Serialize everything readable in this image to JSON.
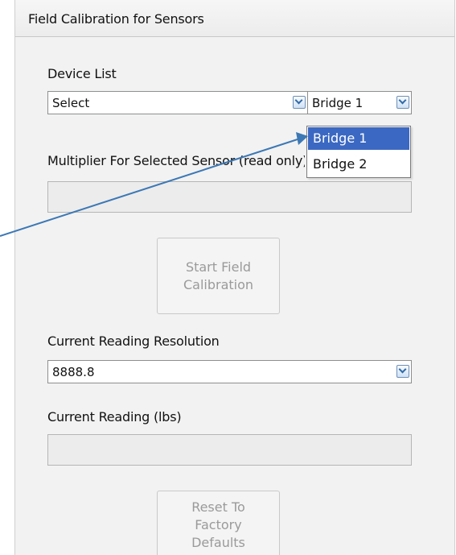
{
  "panel": {
    "title": "Field Calibration for Sensors"
  },
  "device_list": {
    "label": "Device List",
    "value": "Select",
    "icon": "chevron-down-icon"
  },
  "bridge_select": {
    "value": "Bridge 1",
    "icon": "chevron-down-icon",
    "options": [
      {
        "label": "Bridge 1",
        "selected": true
      },
      {
        "label": "Bridge 2",
        "selected": false
      }
    ]
  },
  "multiplier": {
    "label": "Multiplier For Selected Sensor (read only)",
    "value": ""
  },
  "start_button": {
    "label": "Start Field Calibration"
  },
  "resolution": {
    "label": "Current Reading Resolution",
    "value": "8888.8",
    "icon": "chevron-down-icon"
  },
  "current_reading": {
    "label": "Current Reading (lbs)",
    "value": ""
  },
  "reset_button": {
    "label": "Reset To Factory Defaults"
  },
  "colors": {
    "panel_bg": "#f2f2f2",
    "highlight": "#3b68c2",
    "annotation_arrow": "#3c78b5",
    "disabled_text": "#9a9a9a"
  }
}
